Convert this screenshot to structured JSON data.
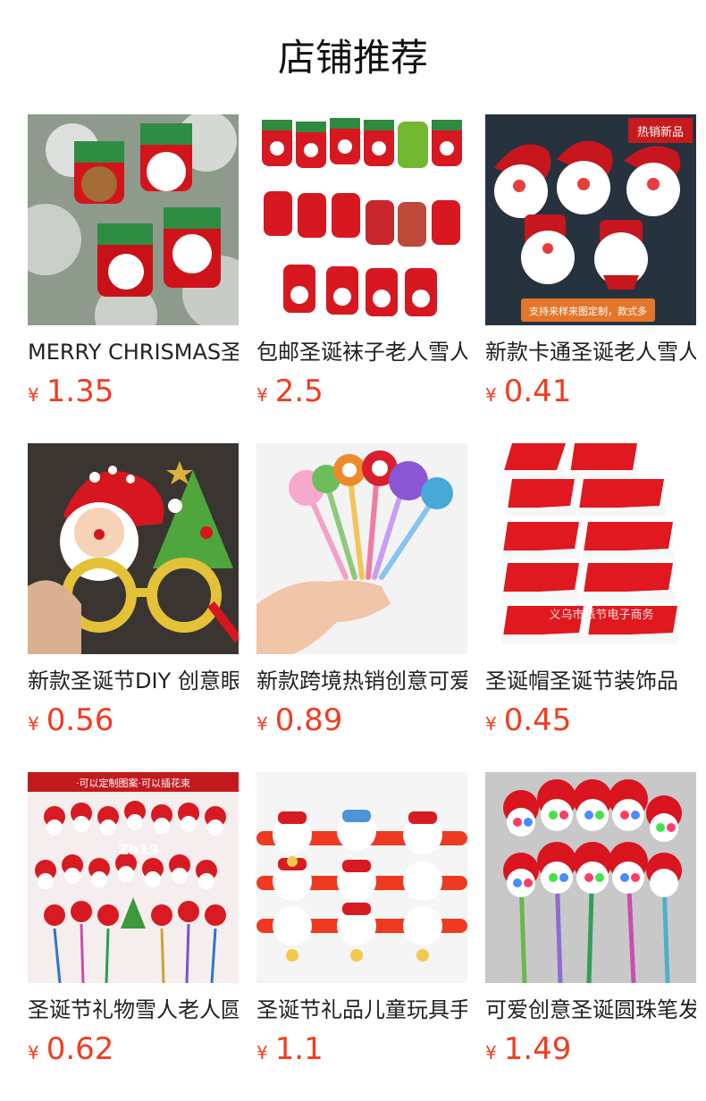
{
  "page": {
    "title": "店铺推荐"
  },
  "colors": {
    "price": "#f23c1f",
    "text": "#222222"
  },
  "products": [
    {
      "name": "MERRY CHRISMAS圣诞节",
      "currency": "¥",
      "price": "1.35",
      "image": "christmas-stocking-ornaments"
    },
    {
      "name": "包邮圣诞袜子老人雪人",
      "currency": "¥",
      "price": "2.5",
      "image": "christmas-stockings-set"
    },
    {
      "name": "新款卡通圣诞老人雪人",
      "currency": "¥",
      "price": "0.41",
      "image": "santa-snowman-brooches",
      "image_text": [
        "热销新品",
        "支持来样来图定制，款式多"
      ]
    },
    {
      "name": "新款圣诞节DIY 创意眼镜",
      "currency": "¥",
      "price": "0.56",
      "image": "christmas-glasses"
    },
    {
      "name": "新款跨境热销创意可爱",
      "currency": "¥",
      "price": "0.89",
      "image": "christmas-pens-hand"
    },
    {
      "name": "圣诞帽圣诞节装饰品",
      "currency": "¥",
      "price": "0.45",
      "image": "santa-hats",
      "image_text": [
        "义乌市派节电子商务"
      ]
    },
    {
      "name": "圣诞节礼物雪人老人圆珠笔",
      "currency": "¥",
      "price": "0.62",
      "image": "christmas-pens-display",
      "image_text": [
        "·可以定制图案·可以插花束",
        "Zb19"
      ]
    },
    {
      "name": "圣诞节礼品儿童玩具手环",
      "currency": "¥",
      "price": "1.1",
      "image": "christmas-slap-bracelets"
    },
    {
      "name": "可爱创意圣诞圆珠笔发光",
      "currency": "¥",
      "price": "1.49",
      "image": "light-up-pens"
    }
  ]
}
